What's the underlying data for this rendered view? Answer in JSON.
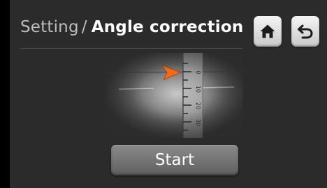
{
  "header": {
    "breadcrumb_parent": "Setting",
    "separator": "/",
    "title": "Angle correction"
  },
  "toolbar": {
    "home_icon": "home-icon",
    "back_icon": "back-arrow-icon"
  },
  "camera_view": {
    "marker_color": "#f26a1b",
    "scale_labels": [
      "0",
      "10",
      "20",
      "30"
    ]
  },
  "actions": {
    "start_label": "Start"
  },
  "colors": {
    "panel_background": "#2b2b2b",
    "outer_background": "#000000",
    "button_gradient_top": "#8a8a8a",
    "icon_color": "#1c1c1c"
  }
}
